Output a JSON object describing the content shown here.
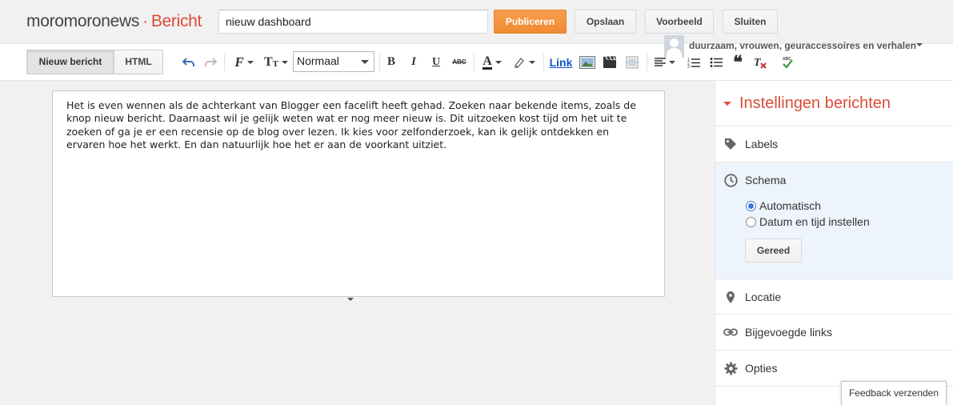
{
  "header": {
    "blog_name": "moromoronews",
    "separator": "·",
    "page_name": "Bericht",
    "title_value": "nieuw dashboard",
    "buttons": {
      "publish": "Publiceren",
      "save": "Opslaan",
      "preview": "Voorbeeld",
      "close": "Sluiten"
    }
  },
  "user": {
    "name": "duurzaam, vrouwen, geuraccessoires en verhalen"
  },
  "toolbar": {
    "mode_compose": "Nieuw bericht",
    "mode_html": "HTML",
    "font_size": "Normaal",
    "link_label": "Link"
  },
  "editor": {
    "content": "Het is even wennen als de achterkant van Blogger een facelift heeft gehad. Zoeken naar bekende items, zoals de knop nieuw bericht. Daarnaast wil je gelijk weten wat er nog meer nieuw is. Dit uitzoeken kost tijd om het uit te zoeken of ga je er een recensie op de blog over lezen. Ik kies voor zelfonderzoek, kan ik gelijk ontdekken en ervaren hoe het werkt. En dan natuurlijk hoe het er aan de voorkant uitziet."
  },
  "sidebar": {
    "title": "Instellingen berichten",
    "labels": "Labels",
    "schedule": "Schema",
    "schedule_options": [
      "Automatisch",
      "Datum en tijd instellen"
    ],
    "schedule_selected": "Automatisch",
    "done": "Gereed",
    "location": "Locatie",
    "links": "Bijgevoegde links",
    "options": "Opties"
  },
  "feedback": "Feedback verzenden",
  "colors": {
    "accent": "#dd4b39",
    "publish": "#f18c33",
    "link": "#1155cc",
    "expanded_bg": "#eef4fc"
  },
  "icons": [
    "undo-icon",
    "redo-icon",
    "font-family-icon",
    "font-size-icon",
    "bold-icon",
    "italic-icon",
    "underline-icon",
    "strikethrough-icon",
    "text-color-icon",
    "highlight-icon",
    "image-icon",
    "video-icon",
    "jump-break-icon",
    "align-icon",
    "numbered-list-icon",
    "bulleted-list-icon",
    "quote-icon",
    "remove-formatting-icon",
    "spellcheck-icon",
    "tag-icon",
    "clock-icon",
    "location-pin-icon",
    "link-chain-icon",
    "gear-icon"
  ]
}
